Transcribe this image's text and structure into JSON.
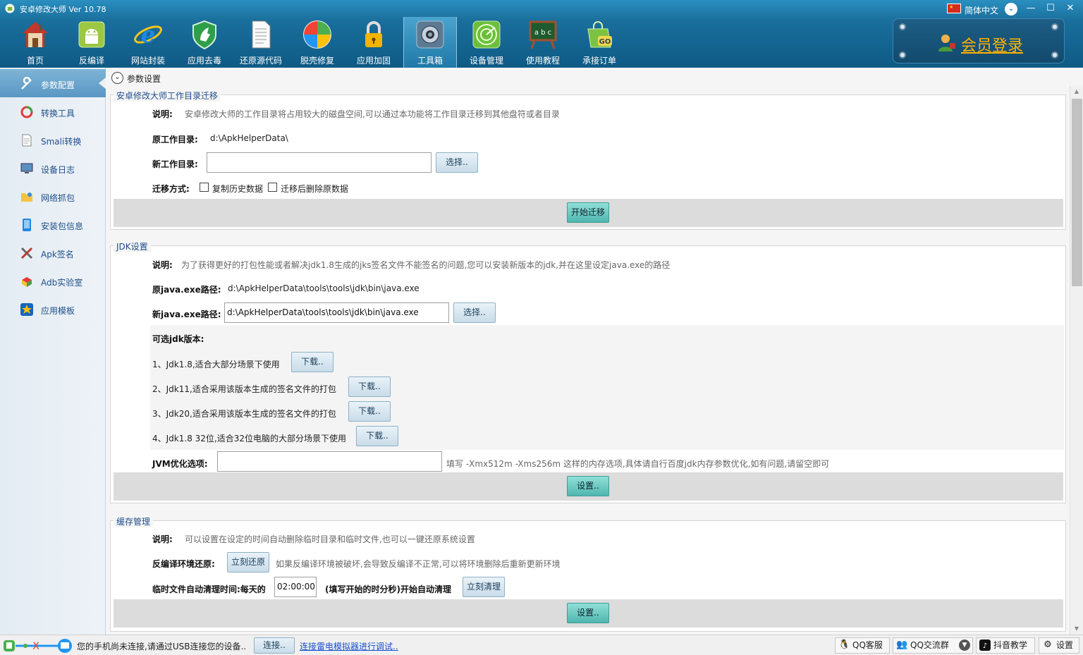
{
  "window": {
    "title": "安卓修改大师 Ver 10.78",
    "language": "简体中文",
    "minimize": "—",
    "maximize": "☐",
    "close": "✕"
  },
  "toolbar": [
    {
      "label": "首页",
      "icon": "home-icon",
      "glyph": "🏠"
    },
    {
      "label": "反编译",
      "icon": "android-icon",
      "glyph": "🤖"
    },
    {
      "label": "网站封装",
      "icon": "ie-icon",
      "glyph": "e"
    },
    {
      "label": "应用去毒",
      "icon": "shield-icon",
      "glyph": "🛡"
    },
    {
      "label": "还原源代码",
      "icon": "document-icon",
      "glyph": "📄"
    },
    {
      "label": "脱壳修复",
      "icon": "windows-icon",
      "glyph": "❖"
    },
    {
      "label": "应用加固",
      "icon": "lock-icon",
      "glyph": "🔒"
    },
    {
      "label": "工具箱",
      "icon": "toolbox-icon",
      "glyph": "⚙"
    },
    {
      "label": "设备管理",
      "icon": "radar-icon",
      "glyph": "◎"
    },
    {
      "label": "使用教程",
      "icon": "blackboard-icon",
      "glyph": "abc"
    },
    {
      "label": "承接订单",
      "icon": "go-bag-icon",
      "glyph": "GO"
    }
  ],
  "member": {
    "label": "会员登录"
  },
  "sidebar": [
    {
      "label": "参数配置",
      "icon": "wrench-icon",
      "glyph": "🔧",
      "active": true
    },
    {
      "label": "转换工具",
      "icon": "convert-icon",
      "glyph": "◉"
    },
    {
      "label": "Smali转换",
      "icon": "file-icon",
      "glyph": "📃"
    },
    {
      "label": "设备日志",
      "icon": "monitor-icon",
      "glyph": "🖥"
    },
    {
      "label": "网络抓包",
      "icon": "folder-icon",
      "glyph": "📁"
    },
    {
      "label": "安装包信息",
      "icon": "package-icon",
      "glyph": "▮"
    },
    {
      "label": "Apk签名",
      "icon": "tools-icon",
      "glyph": "🛠"
    },
    {
      "label": "Adb实验室",
      "icon": "lab-icon",
      "glyph": "⬢"
    },
    {
      "label": "应用模板",
      "icon": "star-icon",
      "glyph": "★"
    }
  ],
  "section": {
    "title": "参数设置",
    "collapse": "⌄"
  },
  "migrate": {
    "legend": "安卓修改大师工作目录迁移",
    "desc_label": "说明:",
    "desc": "安卓修改大师的工作目录将占用较大的磁盘空间,可以通过本功能将工作目录迁移到其他盘符或者目录",
    "old_label": "原工作目录:",
    "old_value": "d:\\ApkHelperData\\",
    "new_label": "新工作目录:",
    "new_value": "",
    "choose": "选择..",
    "method_label": "迁移方式:",
    "opt_copy": "复制历史数据",
    "opt_delete": "迁移后删除原数据",
    "start": "开始迁移"
  },
  "jdk": {
    "legend": "JDK设置",
    "desc_label": "说明:",
    "desc": "为了获得更好的打包性能或者解决jdk1.8生成的jks签名文件不能签名的问题,您可以安装新版本的jdk,并在这里设定java.exe的路径",
    "old_label": "原java.exe路径:",
    "old_value": "d:\\ApkHelperData\\tools\\tools\\jdk\\bin\\java.exe",
    "new_label": "新java.exe路径:",
    "new_value": "d:\\ApkHelperData\\tools\\tools\\jdk\\bin\\java.exe",
    "choose": "选择..",
    "versions_label": "可选jdk版本:",
    "versions": [
      {
        "text": "1、Jdk1.8,适合大部分场景下使用",
        "btn": "下载.."
      },
      {
        "text": "2、Jdk11,适合采用该版本生成的签名文件的打包",
        "btn": "下载.."
      },
      {
        "text": "3、Jdk20,适合采用该版本生成的签名文件的打包",
        "btn": "下载.."
      },
      {
        "text": "4、Jdk1.8 32位,适合32位电脑的大部分场景下使用",
        "btn": "下载.."
      }
    ],
    "jvm_label": "JVM优化选项:",
    "jvm_value": "",
    "jvm_hint": "填写  -Xmx512m -Xms256m 这样的内存选项,具体请自行百度jdk内存参数优化,如有问题,请留空即可",
    "set": "设置.."
  },
  "cache": {
    "legend": "缓存管理",
    "desc_label": "说明:",
    "desc": "可以设置在设定的时间自动删除临时目录和临时文件,也可以一键还原系统设置",
    "restore_label": "反编译环境还原:",
    "restore_btn": "立刻还原",
    "restore_hint": "如果反编译环境被破坏,会导致反编译不正常,可以将环境删除后重新更新环境",
    "clean_label": "临时文件自动清理时间:每天的",
    "clean_time": "02:00:00",
    "clean_hint": "(填写开始的时分秒)开始自动清理",
    "clean_btn": "立刻清理",
    "set": "设置.."
  },
  "status": {
    "message": "您的手机尚未连接,请通过USB连接您的设备..",
    "connect": "连接..",
    "emulator_link": "连接雷电模拟器进行调试..",
    "qq_service": "QQ客服",
    "qq_group": "QQ交流群",
    "douyin": "抖音教学",
    "settings": "设置"
  }
}
